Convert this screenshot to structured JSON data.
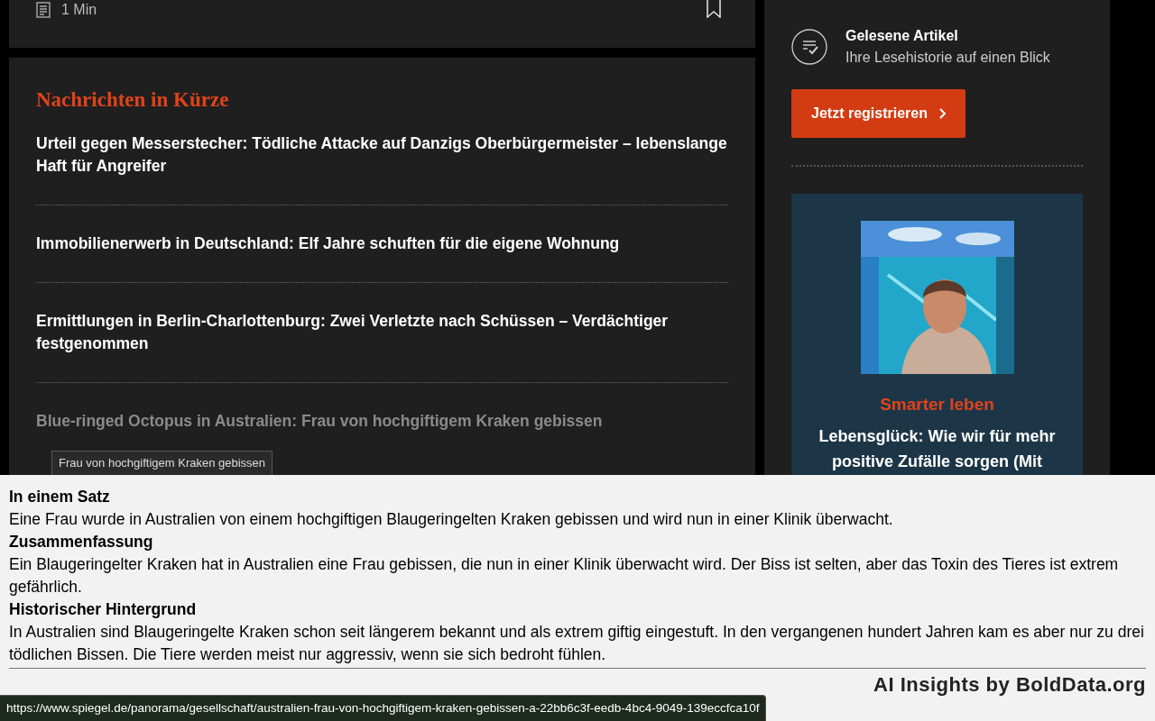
{
  "top_card": {
    "reading_time": "1 Min"
  },
  "news": {
    "title": "Nachrichten in Kürze",
    "items": [
      {
        "title": "Urteil gegen Messerstecher: Tödliche Attacke auf Danzigs Oberbürgermeister – lebenslange Haft für Angreifer",
        "hovered": false
      },
      {
        "title": "Immobilienerwerb in Deutschland: Elf Jahre schuften für die eigene Wohnung",
        "hovered": false
      },
      {
        "title": "Ermittlungen in Berlin-Charlottenburg: Zwei Verletzte nach Schüssen – Verdächtiger festgenommen",
        "hovered": false
      },
      {
        "title": "Blue-ringed Octopus in Australien: Frau von hochgiftigem Kraken gebissen",
        "hovered": true
      }
    ]
  },
  "sidebar": {
    "feature": {
      "title": "Gelesene Artikel",
      "subtitle": "Ihre Lesehistorie auf einen Blick"
    },
    "register_button": "Jetzt registrieren",
    "podcast": {
      "kind": "picture",
      "series": "Smarter leben",
      "episode": "Lebensglück: Wie wir für mehr positive Zufälle sorgen (Mit"
    }
  },
  "tooltip": "Frau von hochgiftigem Kraken gebissen",
  "insights": {
    "sections": [
      {
        "heading": "In einem Satz",
        "text": "Eine Frau wurde in Australien von einem hochgiftigen Blaugeringelten Kraken gebissen und wird nun in einer Klinik überwacht."
      },
      {
        "heading": "Zusammenfassung",
        "text": "Ein Blaugeringelter Kraken hat in Australien eine Frau gebissen, die nun in einer Klinik überwacht wird. Der Biss ist selten, aber das Toxin des Tieres ist extrem gefährlich."
      },
      {
        "heading": "Historischer Hintergrund",
        "text": "In Australien sind Blaugeringelte Kraken schon seit längerem bekannt und als extrem giftig eingestuft. In den vergangenen hundert Jahren kam es aber nur zu drei tödlichen Bissen. Die Tiere werden meist nur aggressiv, wenn sie sich bedroht fühlen."
      }
    ],
    "credit": "AI Insights by BoldData.org"
  },
  "status_bar": {
    "url": "https://www.spiegel.de/panorama/gesellschaft/australien-frau-von-hochgiftigem-kraken-gebissen-a-22bb6c3f-eedb-4bc4-9049-139eccfca10f"
  }
}
